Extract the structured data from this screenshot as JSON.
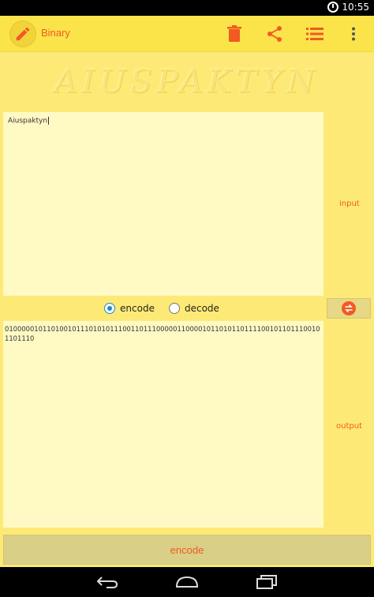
{
  "status_bar": {
    "time": "10:55"
  },
  "app_bar": {
    "title": "Binary",
    "icons": {
      "app": "pencil-icon",
      "delete": "trash-icon",
      "share": "share-icon",
      "list": "list-icon",
      "more": "more-vert-icon"
    }
  },
  "banner": {
    "text": "AIUSPAKTYN"
  },
  "input": {
    "text": "Aiuspaktyn",
    "side_label": "input"
  },
  "mode": {
    "options": [
      {
        "label": "encode",
        "checked": true
      },
      {
        "label": "decode",
        "checked": false
      }
    ]
  },
  "swap_icon": "swap-icon",
  "output": {
    "text": "0100000101101001011101010111001101110000011000010110101101111001011011100101101110",
    "side_label": "output"
  },
  "action_button": {
    "label": "encode"
  },
  "colors": {
    "accent": "#f15a22",
    "background": "#fdea76",
    "panel": "#fff9c4",
    "toolbar": "#fbe44a",
    "radio_checked": "#1e88c8"
  }
}
